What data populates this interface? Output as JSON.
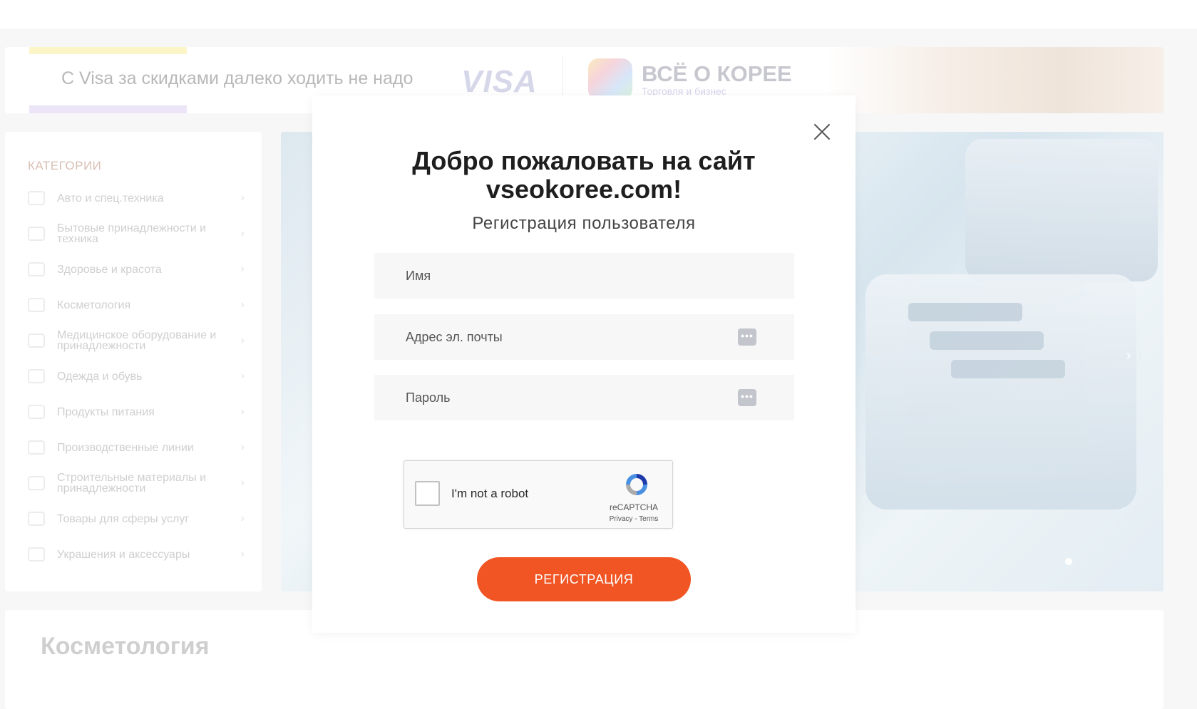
{
  "promo": {
    "text": "С Visa за скидками далеко ходить не надо",
    "visa_logo": "VISA",
    "site_logo_title": "ВСЁ О КОРЕЕ",
    "site_logo_subtitle": "Торговля и бизнес"
  },
  "sidebar": {
    "title": "КАТЕГОРИИ",
    "items": [
      {
        "label": "Авто и спец.техника",
        "icon": "car-icon"
      },
      {
        "label": "Бытовые принадлежности и техника",
        "icon": "washing-machine-icon"
      },
      {
        "label": "Здоровье и красота",
        "icon": "spa-icon"
      },
      {
        "label": "Косметология",
        "icon": "cosmetics-icon"
      },
      {
        "label": "Медицинское оборудование и принадлежности",
        "icon": "medical-icon"
      },
      {
        "label": "Одежда и обувь",
        "icon": "clothes-icon"
      },
      {
        "label": "Продукты питания",
        "icon": "food-icon"
      },
      {
        "label": "Производственные линии",
        "icon": "factory-icon"
      },
      {
        "label": "Строительные материалы и принадлежности",
        "icon": "construction-icon"
      },
      {
        "label": "Товары для сферы услуг",
        "icon": "services-icon"
      },
      {
        "label": "Украшения и аксессуары",
        "icon": "jewelry-icon"
      }
    ],
    "chevron": "›"
  },
  "banner": {
    "next_arrow": "›"
  },
  "section": {
    "title": "Косметология"
  },
  "modal": {
    "title_line1": "Добро пожаловать на сайт",
    "title_line2": "vseokoree.com!",
    "subtitle": "Регистрация пользователя",
    "fields": {
      "name_placeholder": "Имя",
      "name_value": "",
      "email_placeholder": "Адрес эл. почты",
      "email_value": "",
      "password_placeholder": "Пароль",
      "password_value": "",
      "keypass_glyph": "•••"
    },
    "captcha": {
      "label": "I'm not a robot",
      "brand": "reCAPTCHA",
      "terms": "Privacy - Terms"
    },
    "submit_label": "РЕГИСТРАЦИЯ"
  },
  "colors": {
    "accent": "#f05523",
    "modal_bg": "#ffffff",
    "field_bg": "#f7f7f7"
  }
}
